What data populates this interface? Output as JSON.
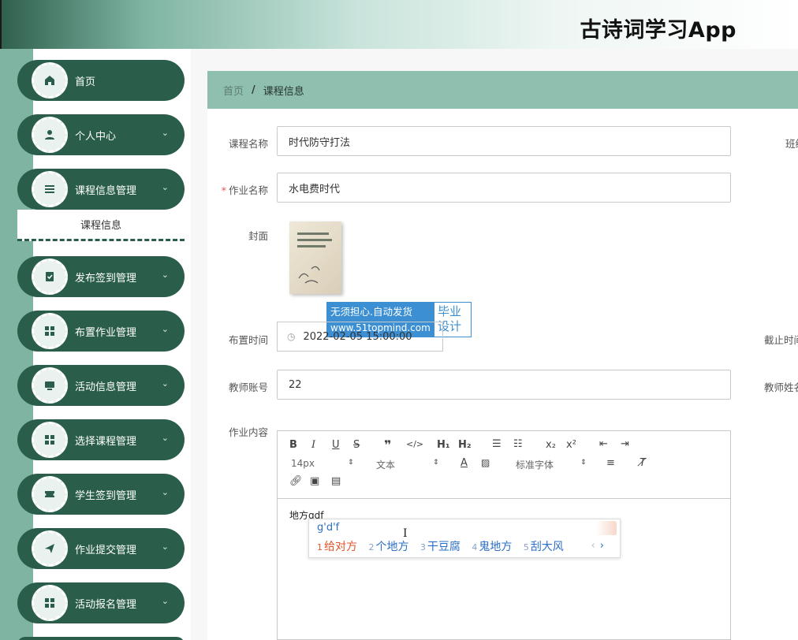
{
  "app": {
    "title": "古诗词学习App"
  },
  "sidebar": {
    "items": [
      {
        "label": "首页",
        "icon": "home-icon"
      },
      {
        "label": "个人中心",
        "icon": "user-icon"
      },
      {
        "label": "课程信息管理",
        "icon": "list-icon"
      },
      {
        "label": "发布签到管理",
        "icon": "clipboard-check-icon"
      },
      {
        "label": "布置作业管理",
        "icon": "grid-icon"
      },
      {
        "label": "活动信息管理",
        "icon": "monitor-icon"
      },
      {
        "label": "选择课程管理",
        "icon": "grid-icon"
      },
      {
        "label": "学生签到管理",
        "icon": "ticket-icon"
      },
      {
        "label": "作业提交管理",
        "icon": "send-icon"
      },
      {
        "label": "活动报名管理",
        "icon": "grid-icon"
      }
    ],
    "submenu_active": "课程信息"
  },
  "breadcrumb": {
    "home": "首页",
    "separator": "/",
    "current": "课程信息"
  },
  "form": {
    "course_name": {
      "label": "课程名称",
      "value": "时代防守打法"
    },
    "class_label_clipped": "班级",
    "homework_name": {
      "label": "作业名称",
      "required_mark": "*",
      "value": "水电费时代"
    },
    "cover": {
      "label": "封面"
    },
    "assign_time": {
      "label": "布置时间",
      "value": "2022-02-05 15:00:00"
    },
    "deadline_label_clipped": "截止时间",
    "teacher_account": {
      "label": "教师账号",
      "value": "22"
    },
    "teacher_name_label_clipped": "教师姓名",
    "content": {
      "label": "作业内容",
      "text": "地方gdf"
    }
  },
  "editor": {
    "font_size": "14px",
    "block_type": "文本",
    "font_family": "标准字体"
  },
  "watermark": {
    "line1": "无须担心.自动发货",
    "line2": "www.51topmind.com",
    "right1": "毕业",
    "right2": "设计"
  },
  "ime": {
    "pinyin": "g'd'f",
    "candidates": [
      {
        "n": "1",
        "text": "给对方"
      },
      {
        "n": "2",
        "text": "个地方"
      },
      {
        "n": "3",
        "text": "干豆腐"
      },
      {
        "n": "4",
        "text": "鬼地方"
      },
      {
        "n": "5",
        "text": "刮大风"
      }
    ],
    "prev": "‹",
    "next": "›"
  },
  "colors": {
    "sidebar_dark": "#2a5e4a",
    "sidebar_light": "#7fb4a2",
    "breadcrumb_bg": "#8fbfae",
    "required": "#e45353"
  }
}
